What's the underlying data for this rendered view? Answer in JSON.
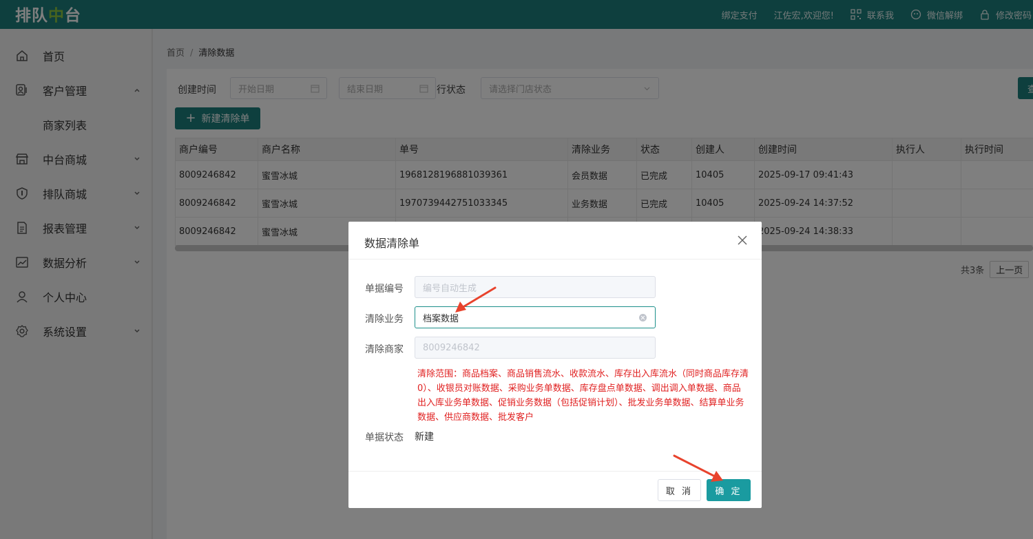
{
  "header": {
    "logo_part1": "排队",
    "logo_part2": "中",
    "logo_part3": "台",
    "nav": {
      "bind_pay": "绑定支付",
      "welcome": "江佐宏,欢迎您!",
      "contact": "联系我",
      "wechat_unbind": "微信解绑",
      "change_password": "修改密码"
    }
  },
  "sidebar": {
    "items": [
      {
        "label": "首页",
        "icon": "home-icon"
      },
      {
        "label": "客户管理",
        "icon": "users-icon"
      },
      {
        "label": "商家列表"
      },
      {
        "label": "中台商城",
        "icon": "store-icon"
      },
      {
        "label": "排队商城",
        "icon": "shield-icon"
      },
      {
        "label": "报表管理",
        "icon": "report-icon"
      },
      {
        "label": "数据分析",
        "icon": "chart-icon"
      },
      {
        "label": "个人中心",
        "icon": "person-icon"
      },
      {
        "label": "系统设置",
        "icon": "gear-icon"
      }
    ]
  },
  "breadcrumb": {
    "home": "首页",
    "separator": "/",
    "current": "清除数据"
  },
  "filters": {
    "created_time_label": "创建时间",
    "start_placeholder": "开始日期",
    "end_placeholder": "结束日期",
    "exec_status_label": "行状态",
    "store_status_placeholder": "请选择门店状态",
    "query_button": "查"
  },
  "new_button": "新建清除单",
  "table": {
    "headers": [
      "商户编号",
      "商户名称",
      "单号",
      "清除业务",
      "状态",
      "创建人",
      "创建时间",
      "执行人",
      "执行时间"
    ],
    "rows": [
      [
        "8009246842",
        "蜜雪冰城",
        "1968128196881039361",
        "会员数据",
        "已完成",
        "10405",
        "2025-09-17 09:41:43",
        "",
        ""
      ],
      [
        "8009246842",
        "蜜雪冰城",
        "1970739442751033345",
        "业务数据",
        "已完成",
        "10405",
        "2025-09-24 14:37:52",
        "",
        ""
      ],
      [
        "8009246842",
        "蜜雪冰城",
        "",
        "",
        "",
        "",
        "2025-09-24 14:38:33",
        "",
        ""
      ]
    ]
  },
  "pagination": {
    "total": "共3条",
    "prev": "上一页"
  },
  "dialog": {
    "title": "数据清除单",
    "doc_no_label": "单据编号",
    "doc_no_placeholder": "编号自动生成",
    "business_label": "清除业务",
    "business_value": "档案数据",
    "merchant_label": "清除商家",
    "merchant_value": "8009246842",
    "scope_text": "清除范围：商品档案、商品销售流水、收款流水、库存出入库流水（同时商品库存清0）、收银员对账数据、采购业务单数据、库存盘点单数据、调出调入单数据、商品出入库业务单数据、促销业务数据（包括促销计划）、批发业务单数据、结算单业务数据、供应商数据、批发客户",
    "status_label": "单据状态",
    "status_value": "新建",
    "cancel": "取 消",
    "confirm": "确 定"
  },
  "colors": {
    "header": "#1c7f7d",
    "primary": "#1a9ba0",
    "warning_text": "#e02020",
    "annotation_arrow": "#e8432d"
  }
}
